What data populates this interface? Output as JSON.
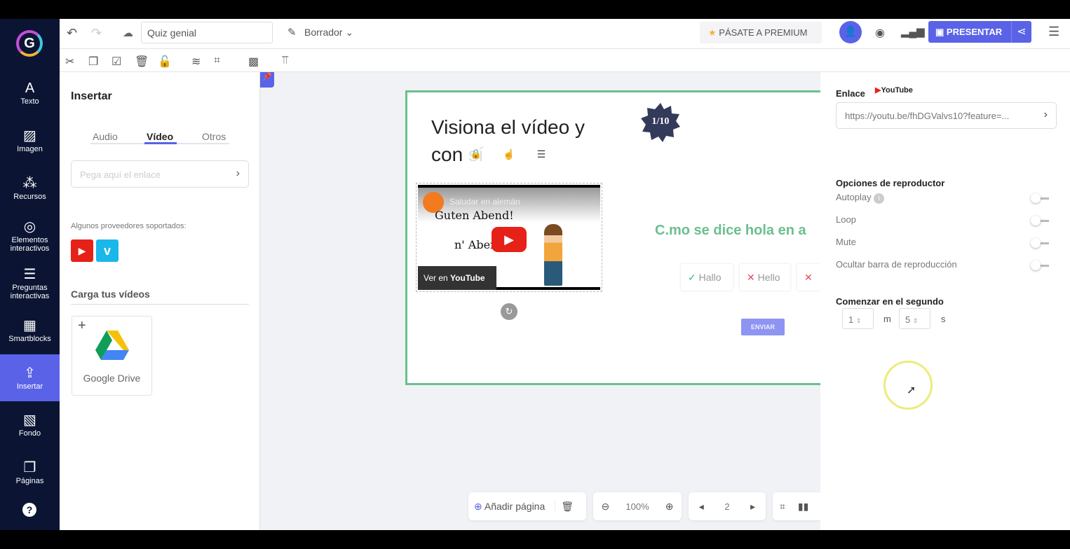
{
  "sidebar": {
    "items": [
      {
        "label": "Texto",
        "icon": "text-icon"
      },
      {
        "label": "Imagen",
        "icon": "image-icon"
      },
      {
        "label": "Recursos",
        "icon": "resources-icon"
      },
      {
        "label": "Elementos interactivos",
        "icon": "interactive-icon"
      },
      {
        "label": "Preguntas interactivas",
        "icon": "questions-icon"
      },
      {
        "label": "Smartblocks",
        "icon": "smartblocks-icon"
      },
      {
        "label": "Insertar",
        "icon": "insert-icon"
      },
      {
        "label": "Fondo",
        "icon": "background-icon"
      },
      {
        "label": "Páginas",
        "icon": "pages-icon"
      }
    ]
  },
  "topbar": {
    "title": "Quiz genial",
    "status": "Borrador",
    "premium": "PÁSATE A PREMIUM",
    "present": "PRESENTAR"
  },
  "leftpanel": {
    "title": "Insertar",
    "tabs": [
      "Audio",
      "Vídeo",
      "Otros"
    ],
    "active_tab": "Vídeo",
    "link_placeholder": "Pega aquí el enlace",
    "providers_label": "Algunos proveedores soportados:",
    "upload_title": "Carga tus vídeos",
    "drive": "Google Drive"
  },
  "slide": {
    "title": "Visiona el vídeo y con sí",
    "badge": "1/10",
    "video_title": "Saludar en alemán",
    "video_text1": "Guten Abend!",
    "video_text2": "n' Aben",
    "watch_on": "Ver en",
    "youtube": "YouTube",
    "question": "C.mo se dice hola en a",
    "answers": [
      "Hallo",
      "Hello",
      ""
    ],
    "submit": "ENVIAR"
  },
  "bottombar": {
    "add_page": "Añadir página",
    "zoom": "100%",
    "page": "2"
  },
  "rightpanel": {
    "link_label": "Enlace",
    "provider": "YouTube",
    "url": "https://youtu.be/fhDGValvs10?feature=...",
    "options_title": "Opciones de reproductor",
    "options": [
      {
        "label": "Autoplay",
        "on": false
      },
      {
        "label": "Loop",
        "on": false
      },
      {
        "label": "Mute",
        "on": false
      },
      {
        "label": "Ocultar barra de reproducción",
        "on": false
      }
    ],
    "start_title": "Comenzar en el segundo",
    "minutes": "1",
    "minutes_unit": "m",
    "seconds": "5",
    "seconds_unit": "s"
  },
  "colors": {
    "accent": "#5a63e8",
    "sidebar": "#0b1533",
    "green": "#6bbf8e"
  }
}
